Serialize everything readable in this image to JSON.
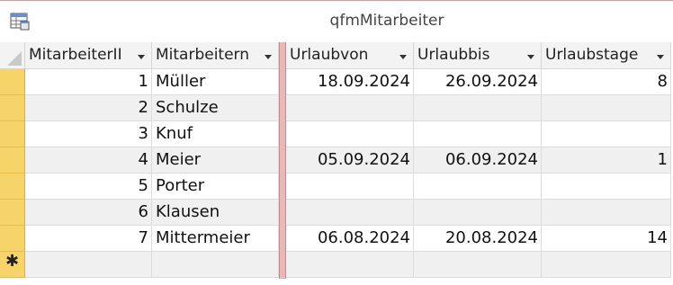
{
  "window": {
    "title": "qfmMitarbeiter",
    "icon": "datasheet-form-icon"
  },
  "columns": [
    {
      "key": "id",
      "label": "MitarbeiterII"
    },
    {
      "key": "name",
      "label": "Mitarbeitern"
    },
    {
      "key": "von",
      "label": "Urlaubvon"
    },
    {
      "key": "bis",
      "label": "Urlaubbis"
    },
    {
      "key": "tage",
      "label": "Urlaubstage"
    }
  ],
  "rows": [
    {
      "id": "1",
      "name": "Müller",
      "von": "18.09.2024",
      "bis": "26.09.2024",
      "tage": "8"
    },
    {
      "id": "2",
      "name": "Schulze",
      "von": "",
      "bis": "",
      "tage": ""
    },
    {
      "id": "3",
      "name": "Knuf",
      "von": "",
      "bis": "",
      "tage": ""
    },
    {
      "id": "4",
      "name": "Meier",
      "von": "05.09.2024",
      "bis": "06.09.2024",
      "tage": "1"
    },
    {
      "id": "5",
      "name": "Porter",
      "von": "",
      "bis": "",
      "tage": ""
    },
    {
      "id": "6",
      "name": "Klausen",
      "von": "",
      "bis": "",
      "tage": ""
    },
    {
      "id": "7",
      "name": "Mittermeier",
      "von": "06.08.2024",
      "bis": "20.08.2024",
      "tage": "14"
    }
  ],
  "new_row_marker": "✱",
  "colors": {
    "row_selector": "#f7d46a",
    "splitter": "#e8b7b7",
    "alt_row": "#f0f0f0"
  }
}
